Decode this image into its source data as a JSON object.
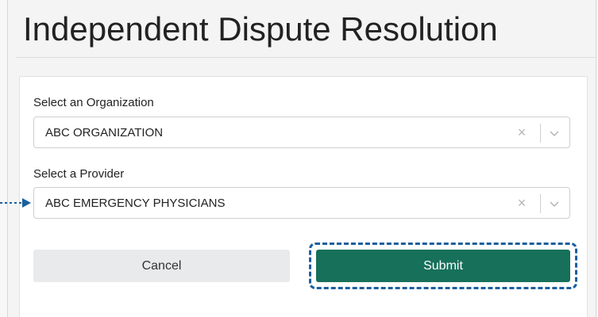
{
  "page": {
    "title": "Independent Dispute Resolution"
  },
  "form": {
    "organization": {
      "label": "Select an Organization",
      "value": "ABC ORGANIZATION",
      "clear_glyph": "×"
    },
    "provider": {
      "label": "Select a Provider",
      "value": "ABC EMERGENCY PHYSICIANS",
      "clear_glyph": "×"
    }
  },
  "actions": {
    "cancel_label": "Cancel",
    "submit_label": "Submit"
  },
  "colors": {
    "submit_bg": "#16705a",
    "cancel_bg": "#e8eaeb",
    "callout": "#1a5f9e"
  },
  "icons": {
    "clear": "close-icon",
    "dropdown": "chevron-down-icon",
    "callout_arrow": "arrow-right-icon"
  }
}
